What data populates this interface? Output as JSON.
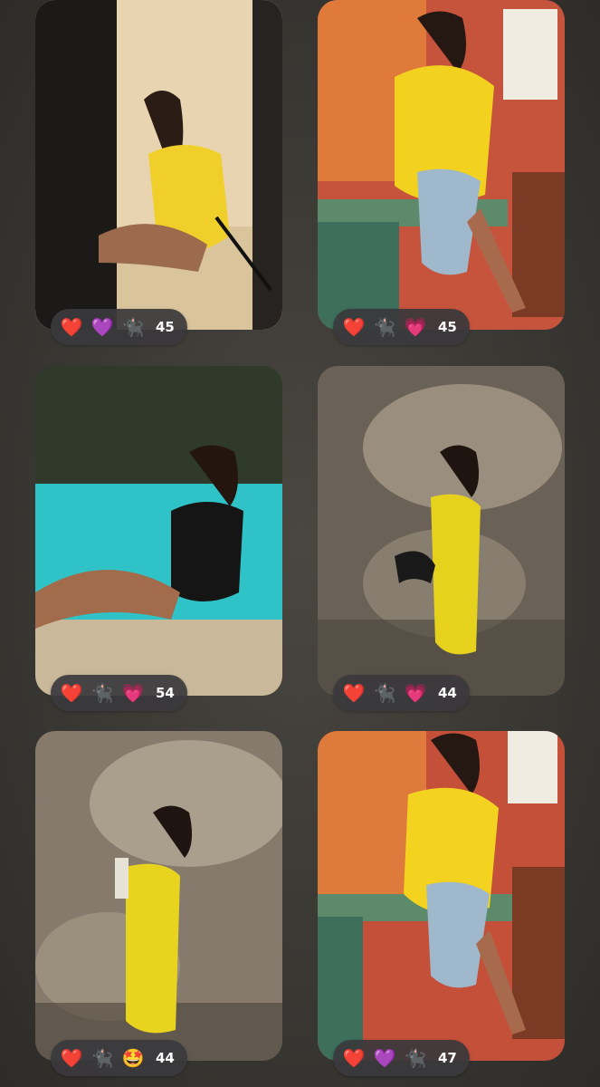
{
  "posts": [
    {
      "photo": "woman-yellow-top-sitting-on-street",
      "reactions": [
        {
          "emoji": "❤️",
          "name": "heart-icon"
        },
        {
          "emoji": "💜",
          "name": "purple-heart-icon"
        },
        {
          "emoji": "🐈‍⬛",
          "name": "black-cat-icon"
        }
      ],
      "count": "45"
    },
    {
      "photo": "woman-yellow-shawl-salon-mirror",
      "reactions": [
        {
          "emoji": "❤️",
          "name": "heart-icon"
        },
        {
          "emoji": "🐈‍⬛",
          "name": "black-cat-icon"
        },
        {
          "emoji": "💗",
          "name": "pink-heart-icon"
        }
      ],
      "count": "45"
    },
    {
      "photo": "woman-black-outfit-by-pool",
      "reactions": [
        {
          "emoji": "❤️",
          "name": "heart-icon"
        },
        {
          "emoji": "🐈‍⬛",
          "name": "black-cat-icon"
        },
        {
          "emoji": "💗",
          "name": "pink-heart-icon"
        }
      ],
      "count": "54"
    },
    {
      "photo": "woman-yellow-dress-leaning-on-wall",
      "reactions": [
        {
          "emoji": "❤️",
          "name": "heart-icon"
        },
        {
          "emoji": "🐈‍⬛",
          "name": "black-cat-icon"
        },
        {
          "emoji": "💗",
          "name": "pink-heart-icon"
        }
      ],
      "count": "44"
    },
    {
      "photo": "woman-yellow-dress-against-wall-laughing",
      "reactions": [
        {
          "emoji": "❤️",
          "name": "heart-icon"
        },
        {
          "emoji": "🐈‍⬛",
          "name": "black-cat-icon"
        },
        {
          "emoji": "🤩",
          "name": "star-struck-icon"
        }
      ],
      "count": "44"
    },
    {
      "photo": "woman-yellow-shawl-salon-pose",
      "reactions": [
        {
          "emoji": "❤️",
          "name": "heart-icon"
        },
        {
          "emoji": "💜",
          "name": "purple-heart-icon"
        },
        {
          "emoji": "🐈‍⬛",
          "name": "black-cat-icon"
        }
      ],
      "count": "47"
    }
  ]
}
